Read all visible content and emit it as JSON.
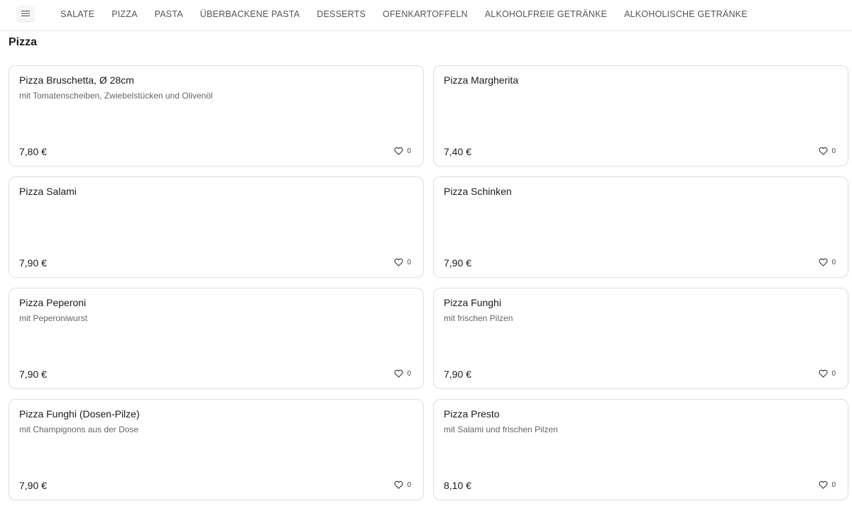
{
  "nav": {
    "menu_icon": "hamburger-icon",
    "items": [
      "SALATE",
      "PIZZA",
      "PASTA",
      "ÜBERBACKENE PASTA",
      "DESSERTS",
      "OFENKARTOFFELN",
      "ALKOHOLFREIE GETRÄNKE",
      "ALKOHOLISCHE GETRÄNKE"
    ]
  },
  "section": {
    "title": "Pizza"
  },
  "products": [
    {
      "name": "Pizza Bruschetta, Ø 28cm",
      "description": "mit Tomatenscheiben, Zwiebelstücken und Olivenöl",
      "price": "7,80 €",
      "likes": "0"
    },
    {
      "name": "Pizza Margherita",
      "description": "",
      "price": "7,40 €",
      "likes": "0"
    },
    {
      "name": "Pizza Salami",
      "description": "",
      "price": "7,90 €",
      "likes": "0"
    },
    {
      "name": "Pizza Schinken",
      "description": "",
      "price": "7,90 €",
      "likes": "0"
    },
    {
      "name": "Pizza Peperoni",
      "description": "mit Peperoniwurst",
      "price": "7,90 €",
      "likes": "0"
    },
    {
      "name": "Pizza Funghi",
      "description": "mit frischen Pilzen",
      "price": "7,90 €",
      "likes": "0"
    },
    {
      "name": "Pizza Funghi (Dosen-Pilze)",
      "description": "mit Champignons aus der Dose",
      "price": "7,90 €",
      "likes": "0"
    },
    {
      "name": "Pizza Presto",
      "description": "mit Salami und frischen Pilzen",
      "price": "8,10 €",
      "likes": "0"
    }
  ],
  "like_icon": "heart-icon"
}
